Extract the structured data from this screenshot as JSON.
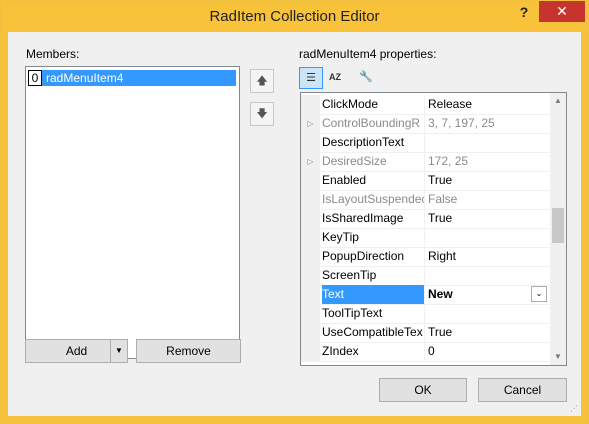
{
  "window": {
    "title": "RadItem Collection Editor",
    "help_glyph": "?",
    "close_glyph": "✕"
  },
  "members": {
    "label": "Members:",
    "items": [
      {
        "index": "0",
        "name": "radMenuItem4"
      }
    ],
    "move_up_glyph": "🡅",
    "move_down_glyph": "🡇",
    "add_label": "Add",
    "add_dropdown_glyph": "▼",
    "remove_label": "Remove"
  },
  "properties": {
    "label": "radMenuItem4 properties:",
    "toolbar": {
      "categorized_glyph": "☰",
      "alphabetical_glyph": "AZ",
      "property_pages_glyph": "🔧"
    },
    "rows": [
      {
        "name": "ClickMode",
        "value": "Release",
        "expandable": false,
        "disabled": false
      },
      {
        "name": "ControlBoundingR",
        "value": "3, 7, 197, 25",
        "expandable": true,
        "disabled": true
      },
      {
        "name": "DescriptionText",
        "value": "",
        "expandable": false,
        "disabled": false
      },
      {
        "name": "DesiredSize",
        "value": "172, 25",
        "expandable": true,
        "disabled": true
      },
      {
        "name": "Enabled",
        "value": "True",
        "expandable": false,
        "disabled": false
      },
      {
        "name": "IsLayoutSuspendec",
        "value": "False",
        "expandable": false,
        "disabled": true
      },
      {
        "name": "IsSharedImage",
        "value": "True",
        "expandable": false,
        "disabled": false
      },
      {
        "name": "KeyTip",
        "value": "",
        "expandable": false,
        "disabled": false
      },
      {
        "name": "PopupDirection",
        "value": "Right",
        "expandable": false,
        "disabled": false
      },
      {
        "name": "ScreenTip",
        "value": "",
        "expandable": false,
        "disabled": false
      },
      {
        "name": "Text",
        "value": "New",
        "expandable": false,
        "disabled": false,
        "selected": true
      },
      {
        "name": "ToolTipText",
        "value": "",
        "expandable": false,
        "disabled": false
      },
      {
        "name": "UseCompatibleTex",
        "value": "True",
        "expandable": false,
        "disabled": false
      },
      {
        "name": "ZIndex",
        "value": "0",
        "expandable": false,
        "disabled": false
      }
    ],
    "dropdown_glyph": "⌄",
    "expand_glyph": "▷",
    "scroll_up_glyph": "▲",
    "scroll_down_glyph": "▼"
  },
  "footer": {
    "ok_label": "OK",
    "cancel_label": "Cancel",
    "grip_glyph": "⋰"
  }
}
